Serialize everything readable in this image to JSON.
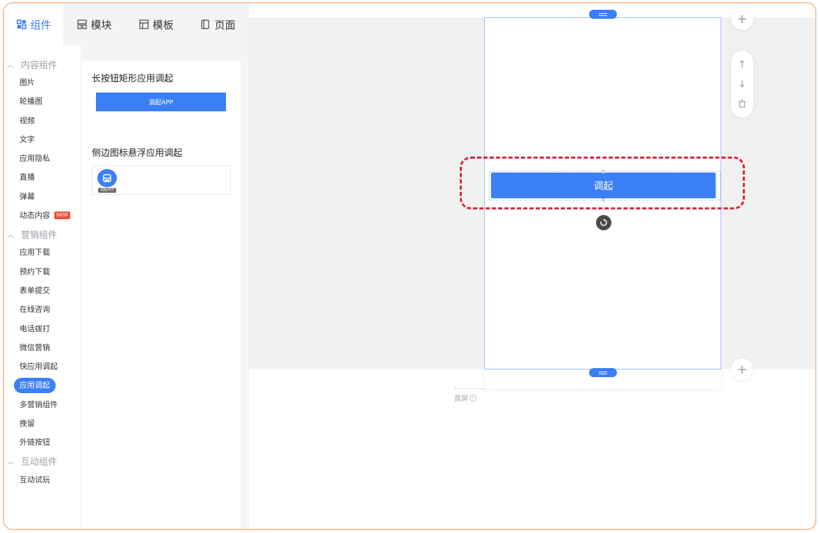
{
  "tabs": [
    {
      "label": "组件",
      "icon": "component-icon"
    },
    {
      "label": "模块",
      "icon": "module-icon"
    },
    {
      "label": "模板",
      "icon": "template-icon"
    },
    {
      "label": "页面",
      "icon": "page-icon"
    }
  ],
  "nav": {
    "content_group": "内容组件",
    "content_items": [
      "图片",
      "轮播图",
      "视频",
      "文字",
      "应用隐私",
      "直播",
      "弹幕",
      "动态内容"
    ],
    "new_badge": "NEW",
    "marketing_group": "营销组件",
    "marketing_items": [
      "应用下载",
      "预约下载",
      "表单提交",
      "在线咨询",
      "电话拨打",
      "微信营销",
      "快应用调起",
      "应用调起",
      "多营销组件",
      "挽留",
      "外链按钮"
    ],
    "interactive_group": "互动组件",
    "interactive_items": [
      "互动试玩"
    ]
  },
  "panel": {
    "section1_title": "长按钮矩形应用调起",
    "section1_button": "调起APP",
    "section2_title": "侧边图标悬浮应用调起",
    "section2_tag": "调起APP"
  },
  "canvas": {
    "call_button_label": "调起",
    "first_screen_label": "首屏"
  },
  "colors": {
    "accent": "#3b7ff5",
    "highlight": "#d8283a"
  }
}
